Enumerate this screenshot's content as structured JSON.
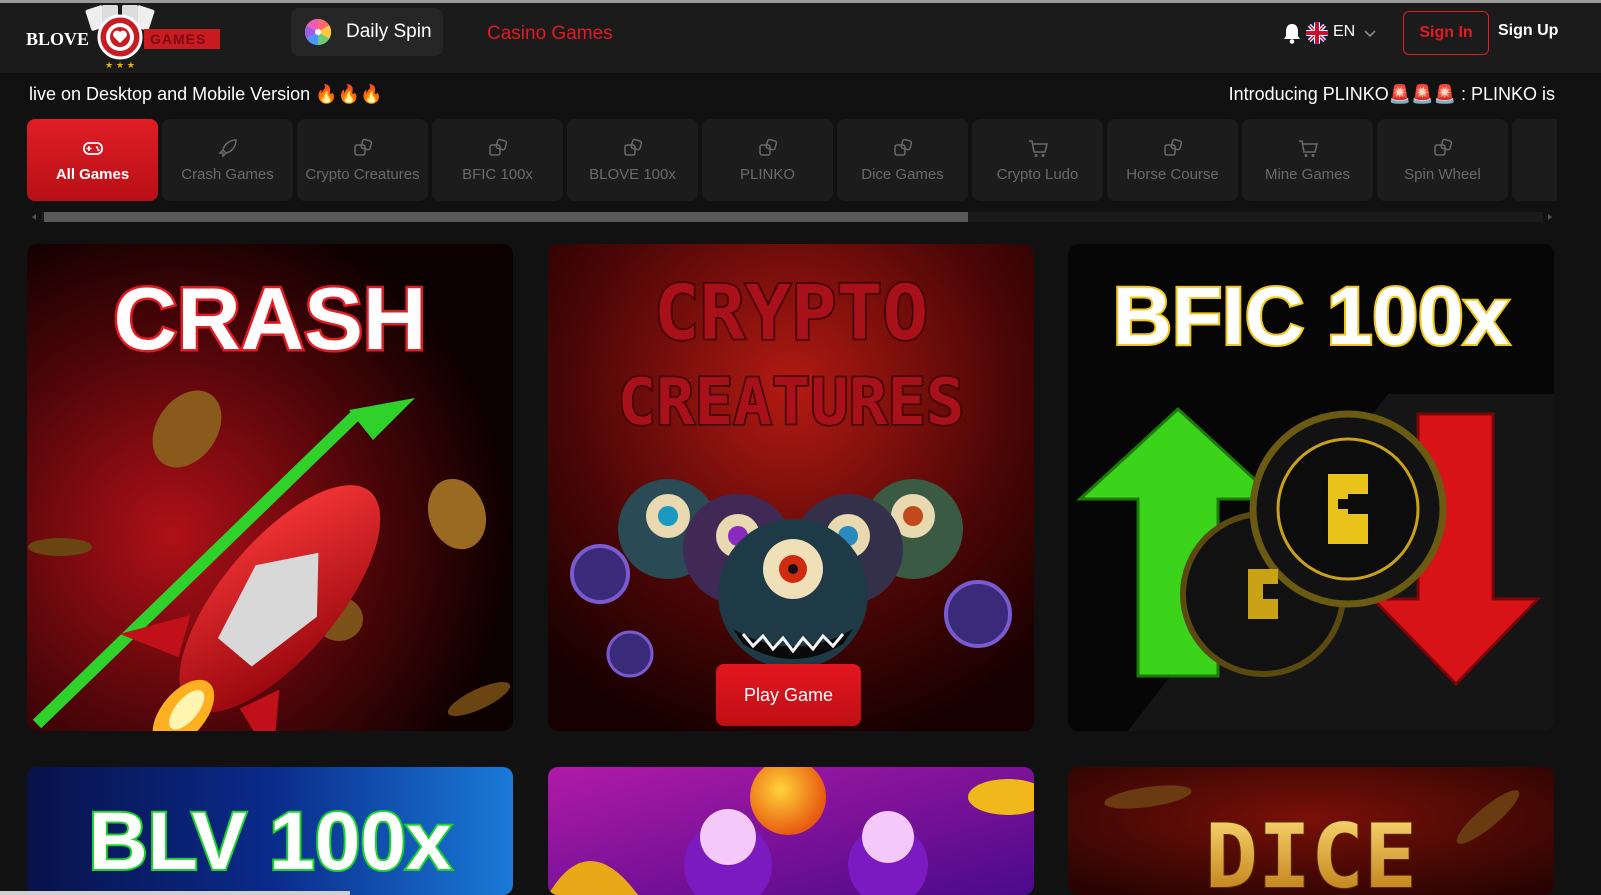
{
  "header": {
    "logo_text_left": "BLOVE",
    "logo_text_right": "GAMES",
    "daily_spin_label": "Daily Spin",
    "casino_games_label": "Casino Games",
    "language": "EN",
    "sign_in_label": "Sign In",
    "sign_up_label": "Sign Up"
  },
  "ticker": {
    "left_text": "live on Desktop and Mobile Version 🔥🔥🔥",
    "right_text": "Introducing PLINKO🚨🚨🚨 : PLINKO is"
  },
  "tabs": [
    {
      "label": "All Games",
      "icon": "gamepad-icon",
      "active": true
    },
    {
      "label": "Crash Games",
      "icon": "rocket-icon",
      "active": false
    },
    {
      "label": "Crypto Creatures",
      "icon": "dice-icon",
      "active": false
    },
    {
      "label": "BFIC 100x",
      "icon": "dice-icon",
      "active": false
    },
    {
      "label": "BLOVE 100x",
      "icon": "dice-icon",
      "active": false
    },
    {
      "label": "PLINKO",
      "icon": "dice-icon",
      "active": false
    },
    {
      "label": "Dice Games",
      "icon": "dice-icon",
      "active": false
    },
    {
      "label": "Crypto Ludo",
      "icon": "cart-icon",
      "active": false
    },
    {
      "label": "Horse Course",
      "icon": "dice-icon",
      "active": false
    },
    {
      "label": "Mine Games",
      "icon": "cart-icon",
      "active": false
    },
    {
      "label": "Spin Wheel",
      "icon": "dice-icon",
      "active": false
    }
  ],
  "games": {
    "crash": {
      "title": "CRASH"
    },
    "crypto_creatures": {
      "title_line1": "CRYPTO",
      "title_line2": "CREATURES",
      "play_label": "Play Game"
    },
    "bfic": {
      "title": "BFIC 100x"
    },
    "blv": {
      "title": "BLV 100x"
    },
    "plinko": {},
    "dice": {
      "title": "DICE"
    }
  },
  "colors": {
    "accent": "#e31b23",
    "background": "#111111",
    "header": "#1b1b1b"
  }
}
